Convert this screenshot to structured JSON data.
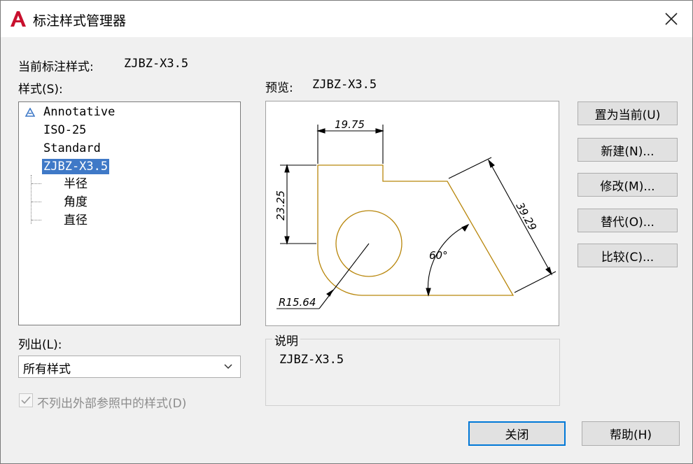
{
  "window": {
    "title": "标注样式管理器"
  },
  "current_style": {
    "label": "当前标注样式:",
    "value": "ZJBZ-X3.5"
  },
  "styles_label": "样式(S):",
  "styles": [
    {
      "label": "Annotative",
      "icon": "annotative-icon"
    },
    {
      "label": "ISO-25"
    },
    {
      "label": "Standard"
    },
    {
      "label": "ZJBZ-X3.5",
      "selected": true
    }
  ],
  "sub_styles": [
    "半径",
    "角度",
    "直径"
  ],
  "preview": {
    "label": "预览:",
    "value": "ZJBZ-X3.5",
    "dims": {
      "top": "19.75",
      "left": "23.25",
      "slant": "39.29",
      "angle": "60°",
      "radius": "R15.64"
    }
  },
  "buttons": {
    "set_current": "置为当前(U)",
    "new": "新建(N)...",
    "modify": "修改(M)...",
    "override": "替代(O)...",
    "compare": "比较(C)...",
    "close": "关闭",
    "help": "帮助(H)"
  },
  "list": {
    "label": "列出(L):",
    "selected": "所有样式"
  },
  "xref_checkbox": {
    "label": "不列出外部参照中的样式(D)",
    "checked": true,
    "disabled": true
  },
  "description": {
    "title": "说明",
    "text": "ZJBZ-X3.5"
  },
  "colors": {
    "selection": "#3f79c7",
    "geometry": "#b8860b",
    "accent": "#0078d7",
    "logo": "#c8102e"
  }
}
